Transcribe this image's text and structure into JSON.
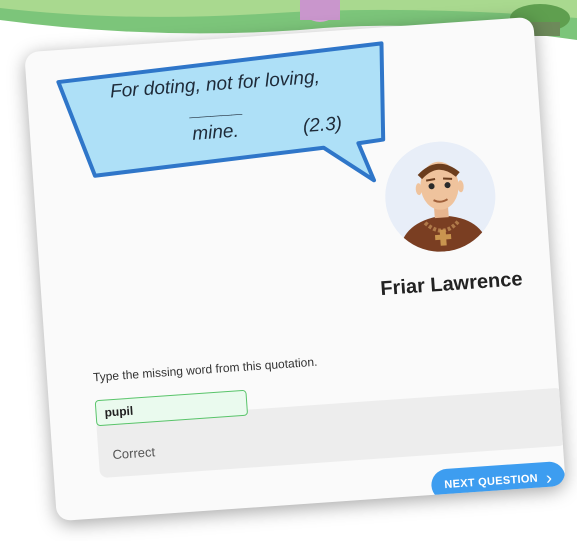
{
  "quiz": {
    "quote_line1": "For doting, not for loving, _____",
    "quote_line2": "mine.",
    "quote_ref": "(2.3)",
    "character_name": "Friar Lawrence",
    "prompt": "Type the missing word from this quotation.",
    "answer_value": "pupil",
    "feedback": "Correct",
    "next_label": "NEXT QUESTION",
    "next_icon": "chevron-right-icon"
  },
  "colors": {
    "bubble": "#aee0f7",
    "bubble_border": "#2f76c9",
    "accent": "#3d9df0",
    "success_border": "#59c46a"
  }
}
